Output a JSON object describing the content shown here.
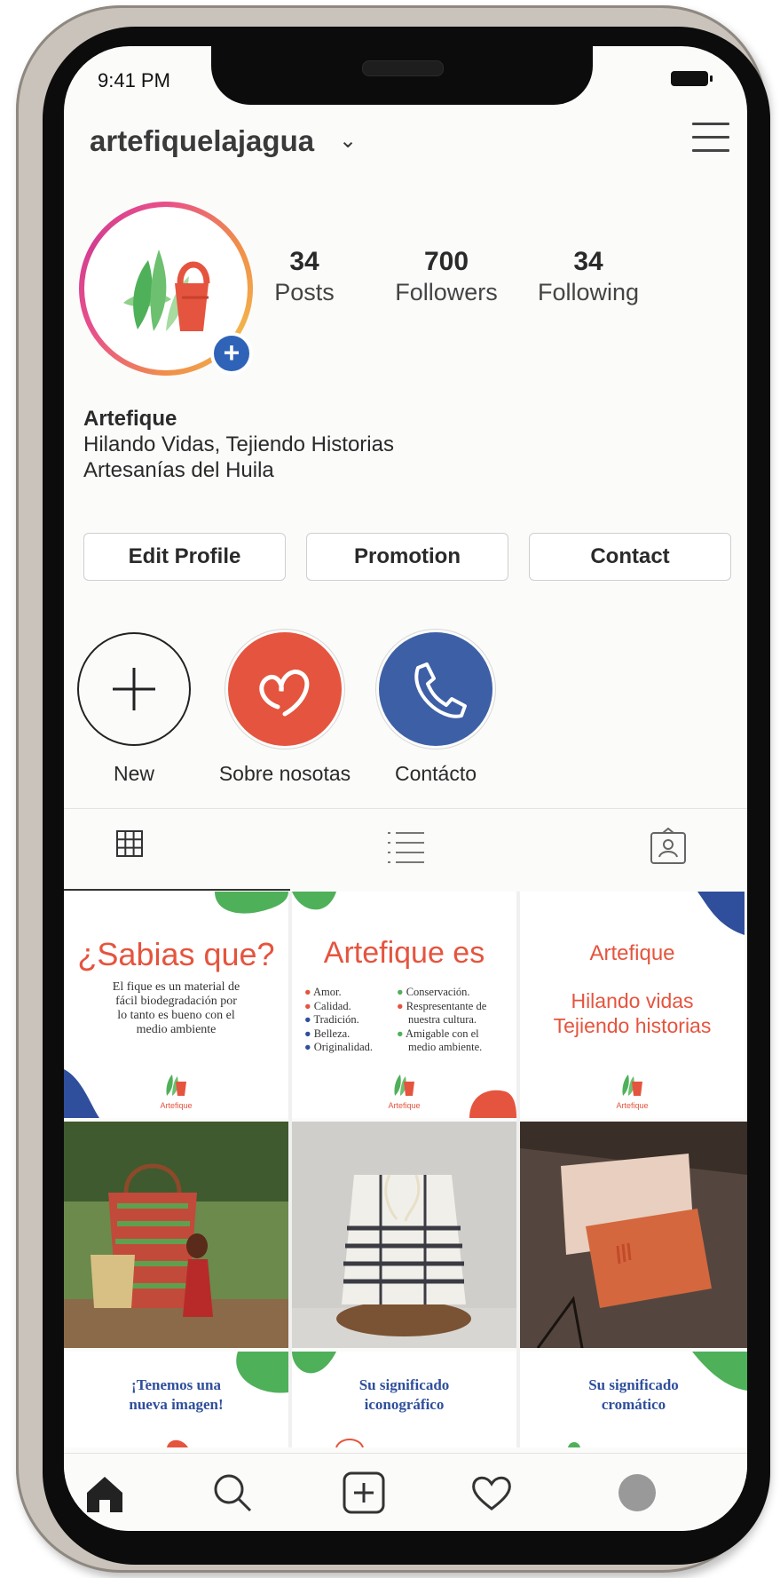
{
  "status_bar": {
    "time": "9:41 PM"
  },
  "profile": {
    "username": "artefiquelajagua",
    "posts": {
      "count": "34",
      "label": "Posts"
    },
    "followers": {
      "count": "700",
      "label": "Followers"
    },
    "following": {
      "count": "34",
      "label": "Following"
    },
    "name": "Artefique",
    "bio_line1": "Hilando Vidas, Tejiendo Historias",
    "bio_line2": "Artesanías del Huila"
  },
  "buttons": {
    "edit": "Edit Profile",
    "promotion": "Promotion",
    "contact": "Contact"
  },
  "highlights": [
    {
      "label": "New"
    },
    {
      "label": "Sobre nosotas"
    },
    {
      "label": "Contácto"
    }
  ],
  "posts": {
    "p1": {
      "title": "¿Sabias que?",
      "body": [
        "El fique es un material de",
        "fácil biodegradación por",
        "lo tanto es bueno con el",
        "medio ambiente"
      ],
      "logo": "Artefique"
    },
    "p2": {
      "title": "Artefique es",
      "left": [
        "Amor.",
        "Calidad.",
        "Tradición.",
        "Belleza.",
        "Originalidad."
      ],
      "right": [
        "Conservación.",
        "Respresentante de",
        "nuestra cultura.",
        "Amigable con el",
        "medio ambiente."
      ],
      "logo": "Artefique"
    },
    "p3": {
      "title": "Artefique",
      "line1": "Hilando vidas",
      "line2": "Tejiendo historias",
      "logo": "Artefique"
    },
    "p7": {
      "line1": "¡Tenemos una",
      "line2": "nueva imagen!"
    },
    "p8": {
      "line1": "Su significado",
      "line2": "iconográfico"
    },
    "p9": {
      "line1": "Su significado",
      "line2": "cromático"
    }
  },
  "colors": {
    "accent_red": "#e5543e",
    "accent_blue": "#2f4f9c",
    "accent_green": "#4fb05a",
    "link_blue": "#2f63b8"
  }
}
